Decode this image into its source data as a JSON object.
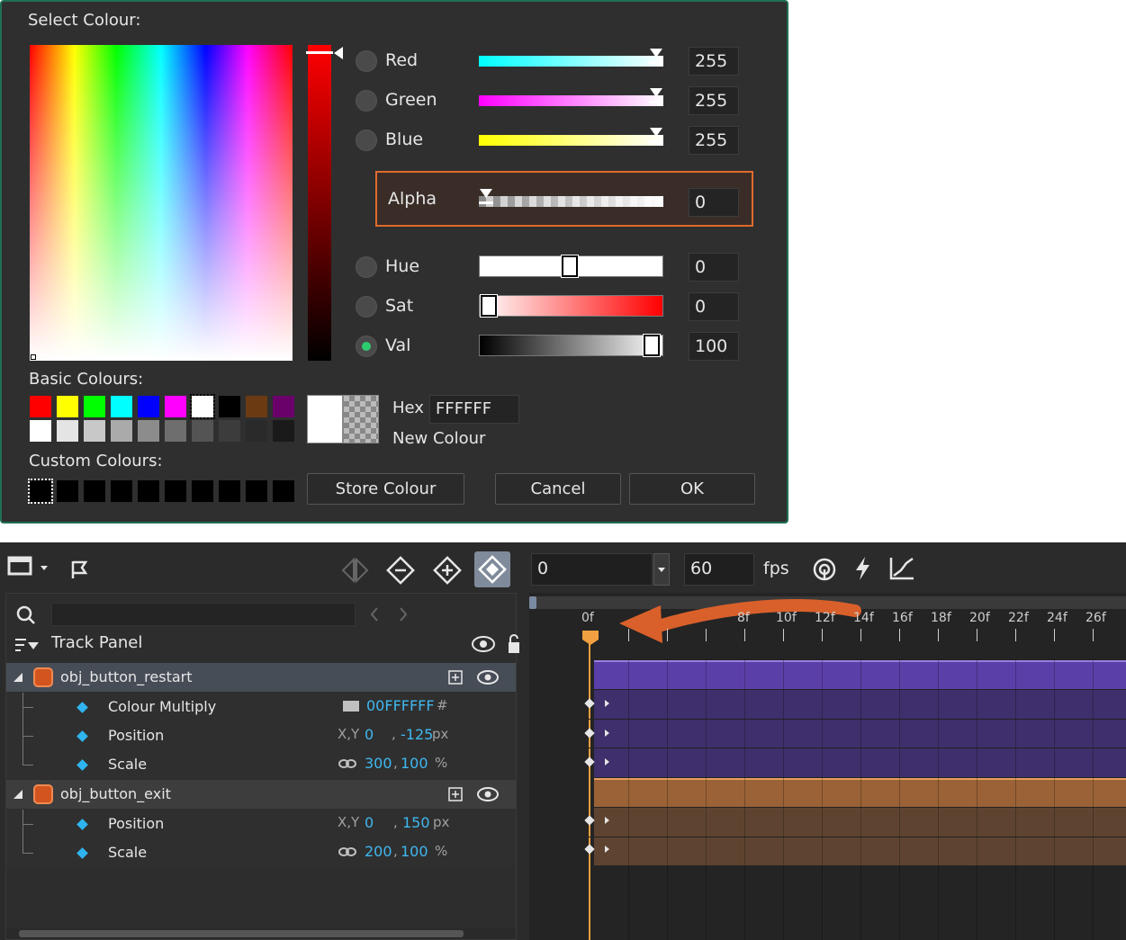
{
  "dialog": {
    "title": "Select Colour:",
    "channels": [
      {
        "label": "Red",
        "value": "255",
        "selected": false
      },
      {
        "label": "Green",
        "value": "255",
        "selected": false
      },
      {
        "label": "Blue",
        "value": "255",
        "selected": false
      },
      {
        "label": "Alpha",
        "value": "0"
      },
      {
        "label": "Hue",
        "value": "0",
        "selected": false
      },
      {
        "label": "Sat",
        "value": "0",
        "selected": false
      },
      {
        "label": "Val",
        "value": "100",
        "selected": true
      }
    ],
    "basic_colours_label": "Basic Colours:",
    "basic_colours_row1": [
      "#ff0000",
      "#ffff00",
      "#00ff00",
      "#00ffff",
      "#0000ff",
      "#ff00ff",
      "#ffffff",
      "#000000",
      "#6b3a12",
      "#6a006a"
    ],
    "basic_colours_row2": [
      "#ffffff",
      "#e4e4e4",
      "#c8c8c8",
      "#aaaaaa",
      "#8c8c8c",
      "#6e6e6e",
      "#545454",
      "#3c3c3c",
      "#2a2a2a",
      "#1a1a1a"
    ],
    "custom_colours_label": "Custom Colours:",
    "hex_label": "Hex",
    "hex_value": "FFFFFF",
    "new_colour_label": "New Colour",
    "store_button": "Store Colour",
    "cancel_button": "Cancel",
    "ok_button": "OK",
    "accent_border": "#1f6f55",
    "alpha_highlight": "#e06a2c"
  },
  "track_panel": {
    "title": "Track Panel",
    "tracks": [
      {
        "name": "obj_button_restart",
        "properties": [
          {
            "name": "Colour Multiply",
            "value": "00FFFFFF",
            "suffix": "#"
          },
          {
            "name": "Position",
            "prefix": "X,Y",
            "x": "0",
            "y": "-125",
            "unit": "px"
          },
          {
            "name": "Scale",
            "x": "300",
            "y": "100",
            "unit": "%"
          }
        ]
      },
      {
        "name": "obj_button_exit",
        "properties": [
          {
            "name": "Position",
            "prefix": "X,Y",
            "x": "0",
            "y": "150",
            "unit": "px"
          },
          {
            "name": "Scale",
            "x": "200",
            "y": "100",
            "unit": "%"
          }
        ]
      }
    ]
  },
  "timeline": {
    "frame_value": "0",
    "fps_value": "60",
    "fps_label": "fps",
    "ruler_labels": [
      "0f",
      "8f",
      "10f",
      "12f",
      "14f",
      "16f",
      "18f",
      "20f",
      "22f",
      "24f",
      "26f"
    ],
    "restart_track_color": "#5b3fa8",
    "exit_track_color": "#a0683a",
    "playhead_color": "#f0a040",
    "annotation_arrow_color": "#d9602b"
  }
}
